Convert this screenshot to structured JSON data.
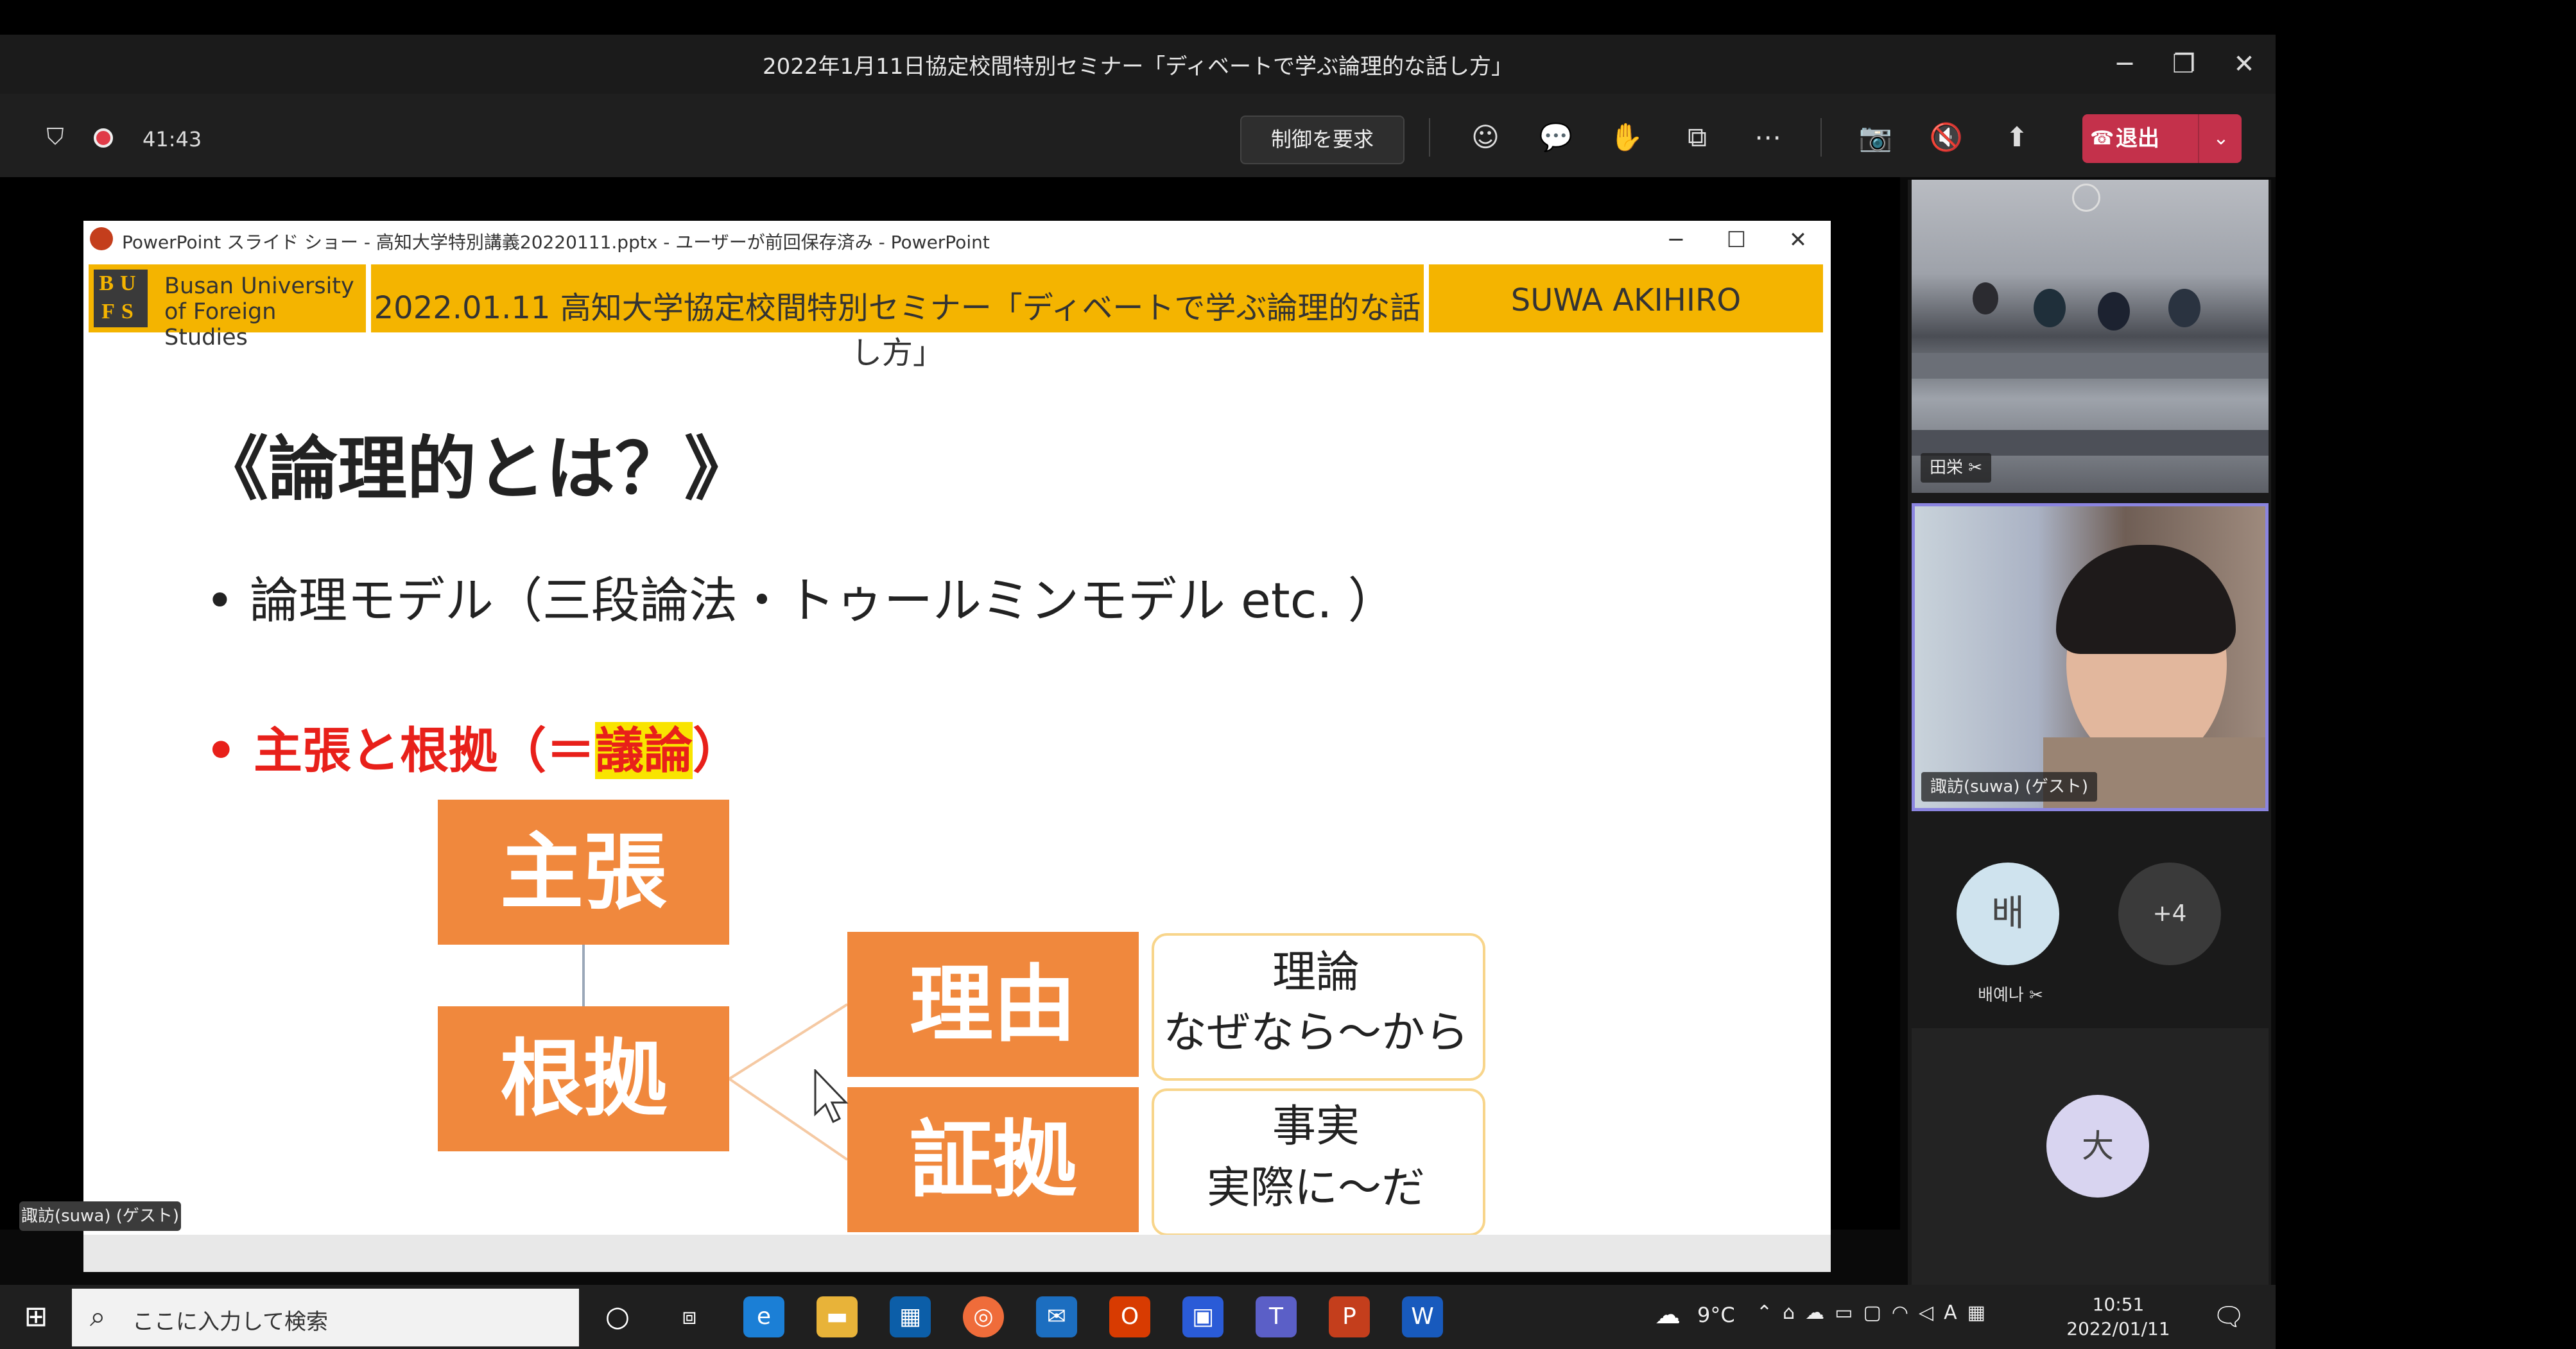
{
  "window": {
    "title": "2022年1月11日協定校間特別セミナー「ディベートで学ぶ論理的な話し方」",
    "minimize": "─",
    "maximize": "❐",
    "close": "✕"
  },
  "toolbar": {
    "timer": "41:43",
    "request_control": "制御を要求",
    "leave": "退出",
    "more": "⋯"
  },
  "powerpoint": {
    "title": "PowerPoint スライド ショー  -  高知大学特別講義20220111.pptx  -  ユーザーが前回保存済み  -  PowerPoint",
    "minimize": "─",
    "maximize": "☐",
    "close": "✕"
  },
  "slide": {
    "logo_letters": "BU\nFS",
    "logo_text_1": "Busan University",
    "logo_text_2": "of Foreign Studies",
    "header_title": "2022.01.11  高知大学協定校間特別セミナー「ディベートで学ぶ論理的な話し方」",
    "header_name": "SUWA AKIHIRO",
    "heading": "《論理的とは？》",
    "bullet1": "• 論理モデル（三段論法・トゥールミンモデル etc. ）",
    "bullet2_pre": "• 主張と根拠（＝",
    "bullet2_hl": "議論",
    "bullet2_post": "）",
    "box_claim": "主張",
    "box_grounds": "根拠",
    "box_reason": "理由",
    "box_evidence": "証拠",
    "reason_line1": "理論",
    "reason_line2": "なぜなら～から",
    "evidence_line1": "事実",
    "evidence_line2": "実際に～だ"
  },
  "presenter_tag": "諏訪(suwa) (ゲスト)",
  "participants": {
    "room_name": "田栄",
    "speaker_name": "諏訪(suwa) (ゲスト)",
    "avatar1_initial": "배",
    "avatar1_name": "배예나",
    "more_count": "+4",
    "avatar3_initial": "大"
  },
  "taskbar": {
    "search_placeholder": "ここに入力して検索",
    "weather": "9°C",
    "time": "10:51",
    "date": "2022/01/11"
  },
  "colors": {
    "slide_orange": "#f0883d",
    "header_yellow": "#f4b400",
    "leave_red": "#c4314b",
    "bullet_red": "#e8201a"
  }
}
